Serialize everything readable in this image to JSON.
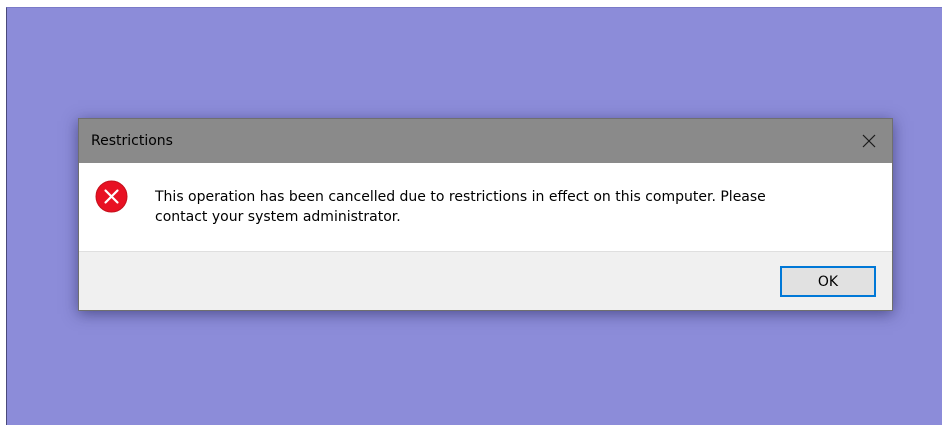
{
  "dialog": {
    "title": "Restrictions",
    "message_line1": "This operation has been cancelled due to restrictions in effect on this computer. Please",
    "message_line2": "contact your system administrator.",
    "ok_label": "OK",
    "icon": "error-icon",
    "close_icon": "close-icon"
  },
  "colors": {
    "desktop": "#8c8cd9",
    "titlebar": "#8a8a8a",
    "footer": "#f0f0f0",
    "button_border": "#0078d7",
    "error": "#e81123"
  }
}
